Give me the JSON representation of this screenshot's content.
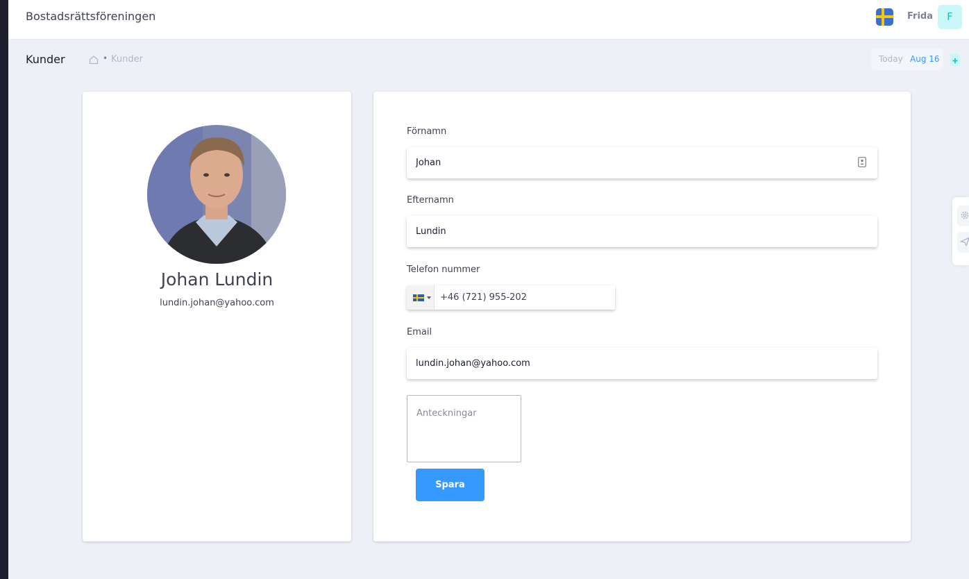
{
  "header": {
    "app_title": "Bostadsrättsföreningen",
    "user_name": "Frida",
    "user_initial": "F"
  },
  "subheader": {
    "page_title": "Kunder",
    "breadcrumb": [
      "Kunder"
    ],
    "date_label": "Today",
    "date_value": "Aug 16"
  },
  "profile": {
    "name": "Johan Lundin",
    "email": "lundin.johan@yahoo.com"
  },
  "form": {
    "first_name_label": "Förnamn",
    "first_name_value": "Johan",
    "last_name_label": "Efternamn",
    "last_name_value": "Lundin",
    "phone_label": "Telefon nummer",
    "phone_value": "+46 (721) 955-202",
    "email_label": "Email",
    "email_value": "lundin.johan@yahoo.com",
    "notes_placeholder": "Anteckningar",
    "save_label": "Spara"
  },
  "colors": {
    "accent": "#3699ff",
    "avatar_bg": "#c9f7f5",
    "avatar_text": "#1bc5bd"
  },
  "icons": [
    "sweden-flag-icon",
    "home-icon",
    "add-file-icon",
    "contact-card-icon",
    "gear-icon",
    "paper-plane-icon",
    "chevron-down-icon"
  ]
}
